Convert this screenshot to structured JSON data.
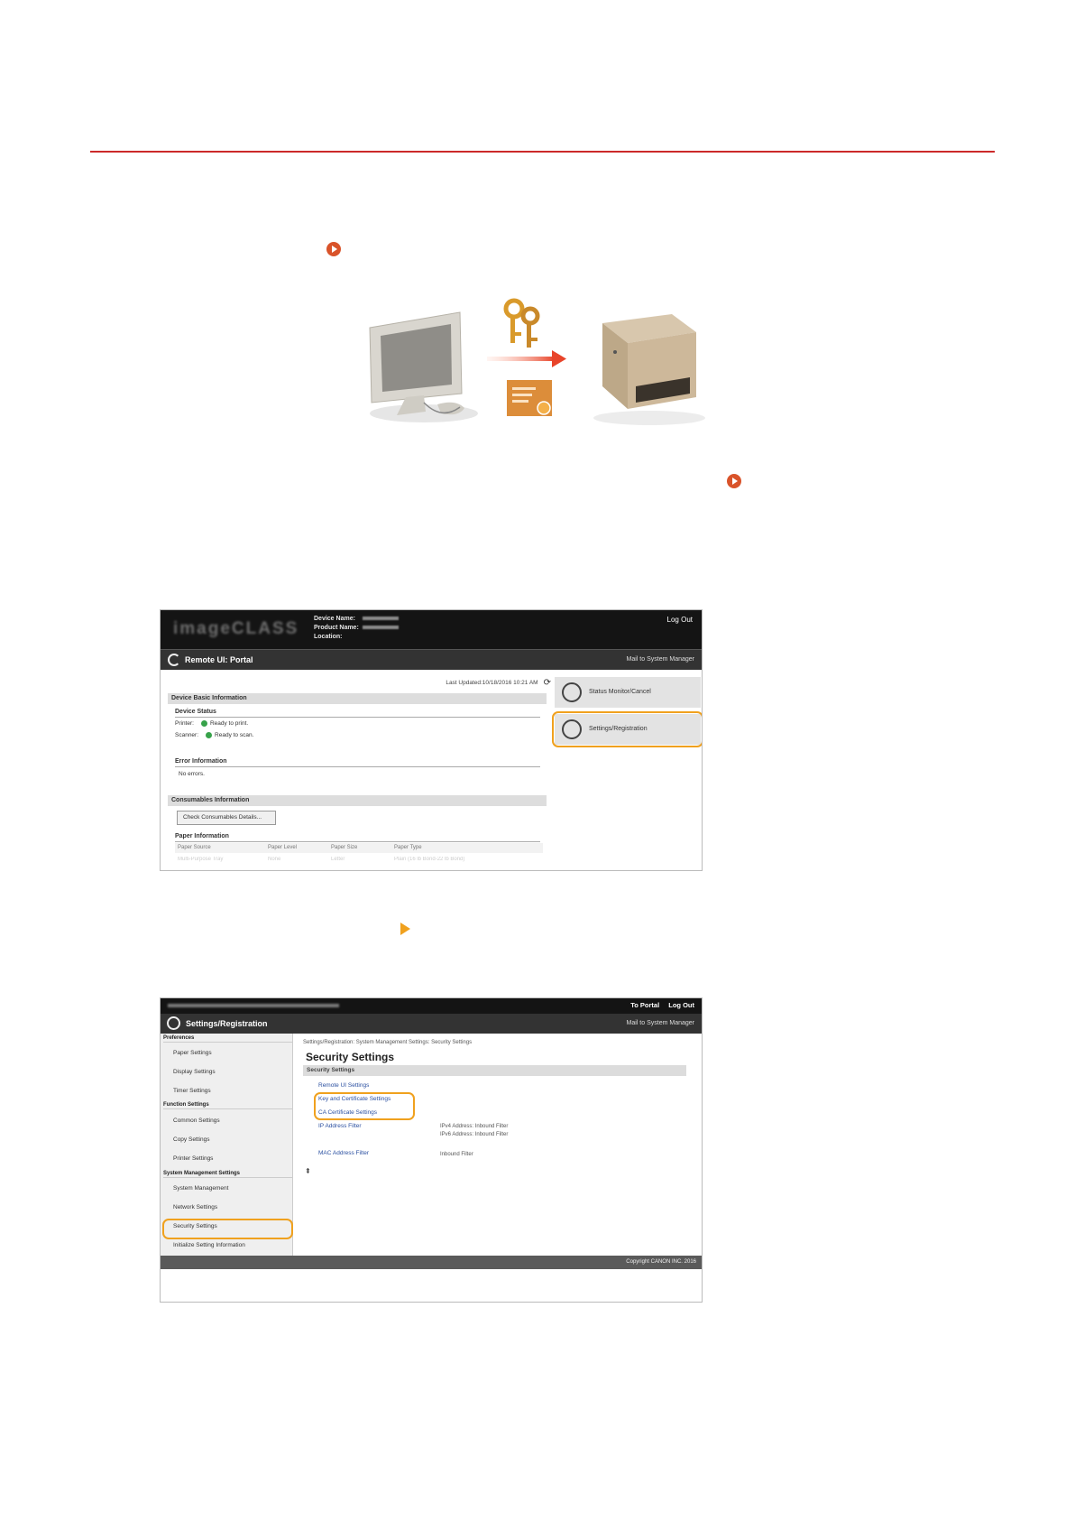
{
  "colors": {
    "rule": "#cc2a2a",
    "reference_icon": "#d9532a",
    "step_arrow": "#f0a11e",
    "highlight": "#f0a11e",
    "status_ok": "#37a24a"
  },
  "illustration": {
    "icons": [
      "computer-icon",
      "keys-icon",
      "arrow-right-icon",
      "certificate-icon",
      "printer-icon"
    ]
  },
  "shot1": {
    "logo": "imageCLASS",
    "device_name_label": "Device Name:",
    "product_name_label": "Product Name:",
    "location_label": "Location:",
    "logout": "Log Out",
    "portal_title": "Remote UI: Portal",
    "mail": "Mail to System Manager",
    "last_updated": "Last Updated:10/18/2016 10:21 AM",
    "device_basic_info": "Device Basic Information",
    "device_status": "Device Status",
    "printer_label": "Printer:",
    "printer_status": "Ready to print.",
    "scanner_label": "Scanner:",
    "scanner_status": "Ready to scan.",
    "error_info": "Error Information",
    "error_text": "No errors.",
    "consumables_info": "Consumables Information",
    "check_consumables_button": "Check Consumables Details...",
    "paper_info": "Paper Information",
    "paper_columns": [
      "Paper Source",
      "Paper Level",
      "Paper Size",
      "Paper Type"
    ],
    "paper_row": [
      "Multi-Purpose Tray",
      "None",
      "Letter",
      "Plain (16 lb Bond-22 lb Bond)"
    ],
    "status_monitor_button": "Status Monitor/Cancel",
    "settings_button": "Settings/Registration"
  },
  "shot2": {
    "to_portal": "To Portal",
    "logout": "Log Out",
    "title": "Settings/Registration",
    "mail": "Mail to System Manager",
    "sidebar": {
      "preferences": "Preferences",
      "paper_settings": "Paper Settings",
      "display_settings": "Display Settings",
      "timer_settings": "Timer Settings",
      "function_settings": "Function Settings",
      "common_settings": "Common Settings",
      "copy_settings": "Copy Settings",
      "printer_settings": "Printer Settings",
      "system_management_settings": "System Management Settings",
      "system_management": "System Management",
      "network_settings": "Network Settings",
      "security_settings": "Security Settings",
      "initialize_setting_information": "Initialize Setting Information"
    },
    "breadcrumb": "Settings/Registration: System Management Settings: Security Settings",
    "page_title": "Security Settings",
    "section_title": "Security Settings",
    "links": {
      "remote_ui": "Remote UI Settings",
      "key_cert": "Key and Certificate Settings",
      "ca_cert": "CA Certificate Settings",
      "ip_filter": "IP Address Filter",
      "mac_filter": "MAC Address Filter"
    },
    "descriptions": {
      "ipv4": "IPv4 Address: Inbound Filter",
      "ipv6": "IPv6 Address: Inbound Filter",
      "inbound": "Inbound Filter"
    },
    "copyright": "Copyright CANON INC. 2016"
  }
}
